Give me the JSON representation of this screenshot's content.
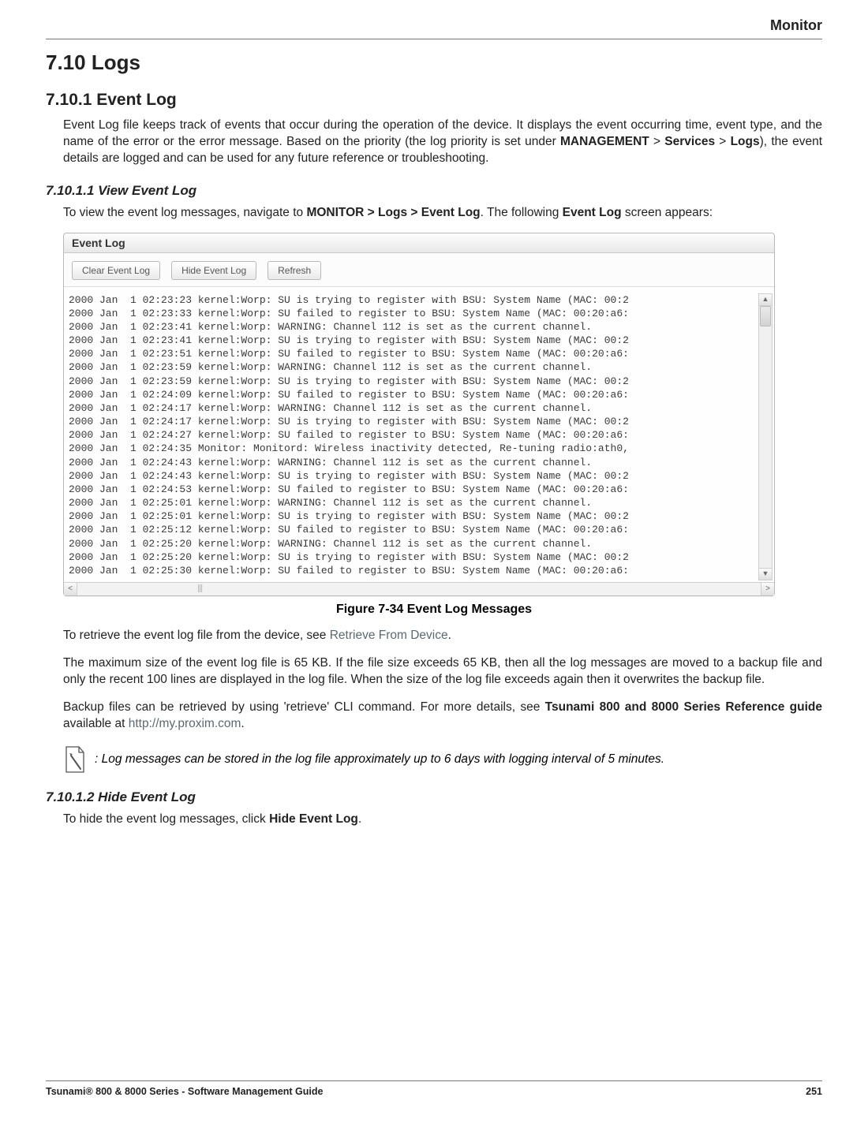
{
  "header": {
    "right": "Monitor"
  },
  "h1": "7.10 Logs",
  "sec1": {
    "title": "7.10.1 Event Log",
    "para1_a": "Event Log file keeps track of events that occur during the operation of the device. It displays the event occurring time, event type, and the name of the error or the error message. Based on the priority (the log priority is set under ",
    "para1_b1": "MANAGEMENT",
    "para1_gt1": " > ",
    "para1_b2": "Services",
    "para1_gt2": " > ",
    "para1_b3": "Logs",
    "para1_c": "), the event details are logged and can be used for any future reference or troubleshooting."
  },
  "sec1_1": {
    "title": "7.10.1.1 View Event Log",
    "lead_a": "To view the event log messages, navigate to ",
    "lead_b": "MONITOR > Logs > Event Log",
    "lead_c": ". The following ",
    "lead_d": "Event Log",
    "lead_e": " screen appears:"
  },
  "panel": {
    "title": "Event Log",
    "buttons": {
      "clear": "Clear Event Log",
      "hide": "Hide Event Log",
      "refresh": "Refresh"
    },
    "lines": [
      "2000 Jan  1 02:23:23 kernel:Worp: SU is trying to register with BSU: System Name (MAC: 00:2",
      "2000 Jan  1 02:23:33 kernel:Worp: SU failed to register to BSU: System Name (MAC: 00:20:a6:",
      "2000 Jan  1 02:23:41 kernel:Worp: WARNING: Channel 112 is set as the current channel.",
      "2000 Jan  1 02:23:41 kernel:Worp: SU is trying to register with BSU: System Name (MAC: 00:2",
      "2000 Jan  1 02:23:51 kernel:Worp: SU failed to register to BSU: System Name (MAC: 00:20:a6:",
      "2000 Jan  1 02:23:59 kernel:Worp: WARNING: Channel 112 is set as the current channel.",
      "2000 Jan  1 02:23:59 kernel:Worp: SU is trying to register with BSU: System Name (MAC: 00:2",
      "2000 Jan  1 02:24:09 kernel:Worp: SU failed to register to BSU: System Name (MAC: 00:20:a6:",
      "2000 Jan  1 02:24:17 kernel:Worp: WARNING: Channel 112 is set as the current channel.",
      "2000 Jan  1 02:24:17 kernel:Worp: SU is trying to register with BSU: System Name (MAC: 00:2",
      "2000 Jan  1 02:24:27 kernel:Worp: SU failed to register to BSU: System Name (MAC: 00:20:a6:",
      "2000 Jan  1 02:24:35 Monitor: Monitord: Wireless inactivity detected, Re-tuning radio:ath0,",
      "2000 Jan  1 02:24:43 kernel:Worp: WARNING: Channel 112 is set as the current channel.",
      "2000 Jan  1 02:24:43 kernel:Worp: SU is trying to register with BSU: System Name (MAC: 00:2",
      "2000 Jan  1 02:24:53 kernel:Worp: SU failed to register to BSU: System Name (MAC: 00:20:a6:",
      "2000 Jan  1 02:25:01 kernel:Worp: WARNING: Channel 112 is set as the current channel.",
      "2000 Jan  1 02:25:01 kernel:Worp: SU is trying to register with BSU: System Name (MAC: 00:2",
      "2000 Jan  1 02:25:12 kernel:Worp: SU failed to register to BSU: System Name (MAC: 00:20:a6:",
      "2000 Jan  1 02:25:20 kernel:Worp: WARNING: Channel 112 is set as the current channel.",
      "2000 Jan  1 02:25:20 kernel:Worp: SU is trying to register with BSU: System Name (MAC: 00:2",
      "2000 Jan  1 02:25:30 kernel:Worp: SU failed to register to BSU: System Name (MAC: 00:20:a6:"
    ]
  },
  "figcaption": "Figure 7-34 Event Log Messages",
  "after": {
    "p1_a": "To retrieve the event log file from the device, see ",
    "p1_link": "Retrieve From Device",
    "p1_b": ".",
    "p2": "The maximum size of the event log file is 65 KB. If the file size exceeds 65 KB, then all the log messages are moved to a backup file and only the recent 100 lines are displayed in the log file. When the size of the log file exceeds again then it overwrites the backup file.",
    "p3_a": "Backup files can be retrieved by using 'retrieve' CLI command. For more details, see ",
    "p3_b": "Tsunami 800 and 8000 Series Reference guide",
    "p3_c": " available at ",
    "p3_link": "http://my.proxim.com",
    "p3_d": "."
  },
  "note": ": Log messages can be stored in the log file approximately up to 6 days with logging interval of 5 minutes.",
  "sec1_2": {
    "title": "7.10.1.2 Hide Event Log",
    "text_a": "To hide the event log messages, click ",
    "text_b": "Hide Event Log",
    "text_c": "."
  },
  "footer": {
    "left": "Tsunami® 800 & 8000 Series - Software Management Guide",
    "right": "251"
  }
}
